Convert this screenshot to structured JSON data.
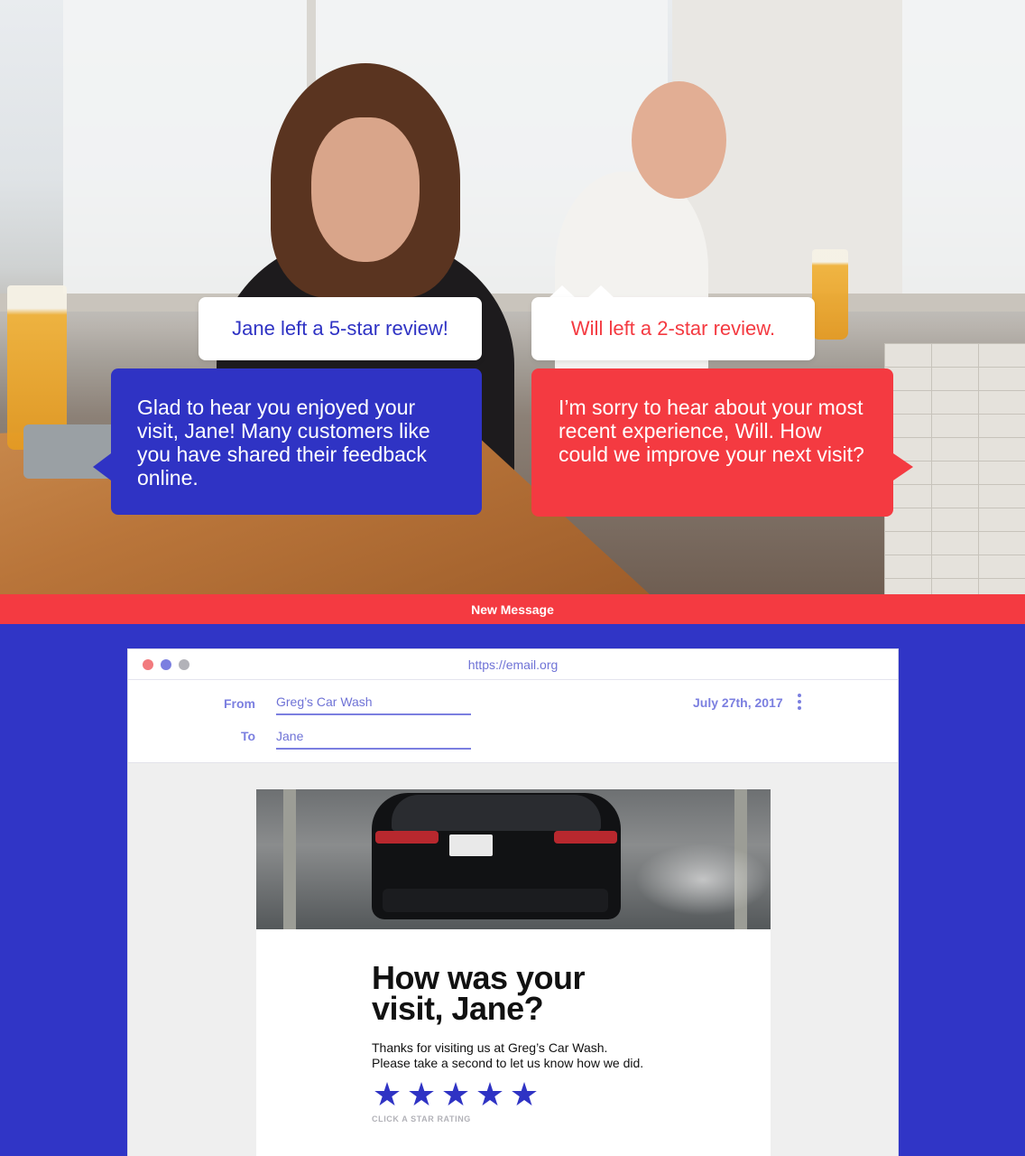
{
  "callouts": {
    "jane_review": "Jane left a 5-star review!",
    "will_review": "Will left a 2-star review.",
    "jane_reply": "Glad to hear you enjoyed your visit, Jane! Many customers like you have shared their feedback online.",
    "will_reply": "I’m sorry to hear about your most recent experience, Will. How could we improve your next visit?"
  },
  "message_bar": {
    "title": "New Message"
  },
  "email": {
    "url": "https://email.org",
    "from_label": "From",
    "from_value": "Greg’s Car Wash",
    "to_label": "To",
    "to_value": "Jane",
    "date": "July 27th, 2017",
    "headline": "How was your visit, Jane?",
    "body_line_1": "Thanks for visiting us at Greg’s Car Wash.",
    "body_line_2": "Please take a second to let us know how we did.",
    "rating": {
      "stars": 5,
      "star_glyph": "★"
    },
    "rating_hint": "CLICK A STAR RATING"
  },
  "colors": {
    "brand_blue": "#2f33c4",
    "brand_red": "#f43a41",
    "accent_lavender": "#7b7fe0"
  }
}
